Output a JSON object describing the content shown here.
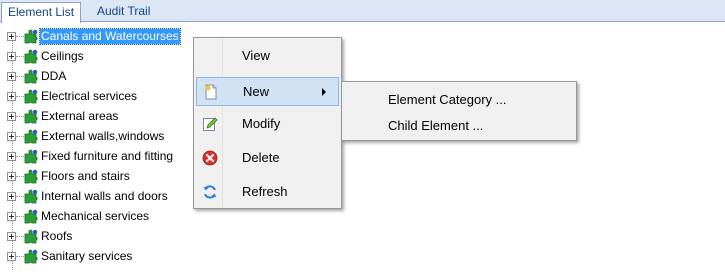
{
  "tabs": [
    {
      "label": "Element List",
      "active": true
    },
    {
      "label": "Audit Trail",
      "active": false
    }
  ],
  "tree": {
    "items": [
      {
        "label": "Canals and Watercourses",
        "selected": true
      },
      {
        "label": "Ceilings"
      },
      {
        "label": "DDA"
      },
      {
        "label": "Electrical services"
      },
      {
        "label": "External areas"
      },
      {
        "label": "External walls,windows"
      },
      {
        "label": "Fixed furniture and fitting"
      },
      {
        "label": "Floors and stairs"
      },
      {
        "label": "Internal walls and doors"
      },
      {
        "label": "Mechanical services"
      },
      {
        "label": "Roofs"
      },
      {
        "label": "Sanitary services"
      }
    ]
  },
  "context_menu": {
    "items": [
      {
        "label": "View",
        "icon": "none"
      },
      {
        "label": "New",
        "icon": "new-document-icon",
        "has_submenu": true,
        "highlighted": true
      },
      {
        "label": "Modify",
        "icon": "edit-icon"
      },
      {
        "label": "Delete",
        "icon": "delete-icon"
      },
      {
        "label": "Refresh",
        "icon": "refresh-icon"
      }
    ]
  },
  "submenu": {
    "items": [
      {
        "label": "Element Category ..."
      },
      {
        "label": "Child Element ..."
      }
    ]
  },
  "colors": {
    "selection": "#3399ff",
    "menu_highlight": "#d1e2f2",
    "tab_text": "#15428b"
  }
}
